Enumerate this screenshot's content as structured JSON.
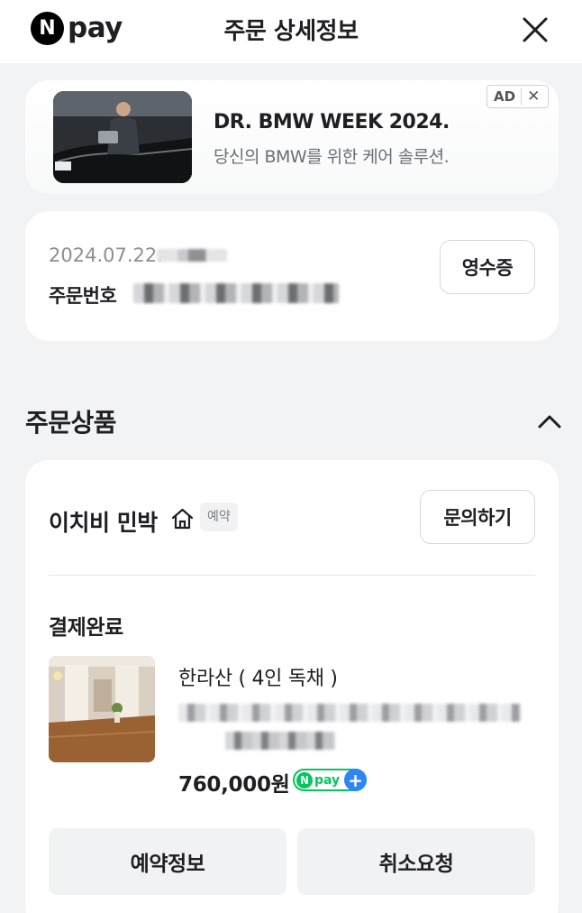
{
  "header": {
    "logo_badge": "N",
    "logo_text": "pay",
    "title": "주문 상세정보",
    "close_icon": "close-icon"
  },
  "ad": {
    "title": "DR. BMW WEEK 2024.",
    "subtitle": "당신의 BMW를 위한 케어 솔루션.",
    "badge_label": "AD",
    "badge_close": "✕"
  },
  "order": {
    "date": "2024.07.22.",
    "number_label": "주문번호",
    "receipt_button": "영수증"
  },
  "section": {
    "title": "주문상품",
    "collapse_icon": "chevron-up-icon"
  },
  "product": {
    "shop_name": "이치비 민박",
    "shop_icon": "home-icon",
    "tag": "예약",
    "inquiry_button": "문의하기",
    "status": "결제완료",
    "name": "한라산 ( 4인 독채 )",
    "price": "760,000원",
    "npay_plus_badge": "pay",
    "npay_plus_n": "N",
    "npay_plus_plus": "+",
    "reserve_button": "예약정보",
    "cancel_button": "취소요청"
  },
  "colors": {
    "background": "#f2f3f5",
    "card": "#ffffff",
    "npay_green": "#03c75a",
    "plus_blue": "#2e86f5"
  }
}
